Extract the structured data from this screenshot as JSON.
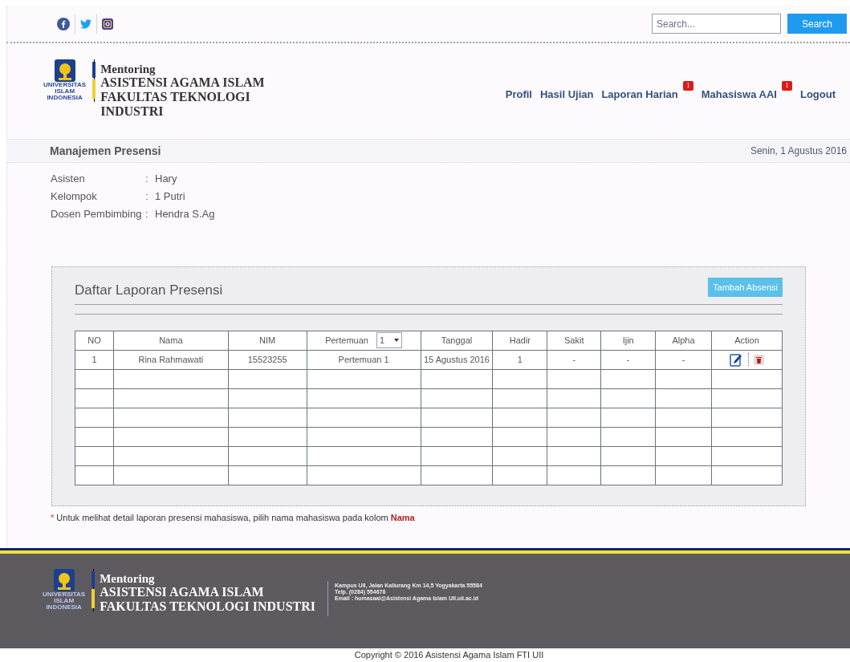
{
  "top_bar": {
    "search": {
      "placeholder": "Search..."
    },
    "search_button": "Search"
  },
  "header": {
    "logo_text": [
      "UNIVERSITAS",
      "ISLAM",
      "INDONESIA"
    ],
    "title_lines": [
      "Mentoring",
      "ASISTENSI AGAMA ISLAM",
      "FAKULTAS TEKNOLOGI",
      "INDUSTRI"
    ],
    "nav": [
      {
        "label": "Profil"
      },
      {
        "label": "Hasil Ujian"
      },
      {
        "label": "Laporan Harian",
        "badge": "1"
      },
      {
        "label": "Mahasiswa AAI",
        "badge": "1"
      },
      {
        "label": "Logout"
      }
    ]
  },
  "page_bar": {
    "title": "Manajemen Presensi",
    "date": "Senin, 1 Agustus 2016"
  },
  "info": [
    {
      "label": "Asisten",
      "separator": ":",
      "value": "Hary"
    },
    {
      "label": "Kelompok",
      "separator": ":",
      "value": "1 Putri"
    },
    {
      "label": "Dosen Pembimbing",
      "separator": ":",
      "value": "Hendra S.Ag"
    }
  ],
  "panel": {
    "title": "Daftar Laporan Presensi",
    "add_button": "Tambah Absensi",
    "table": {
      "columns": [
        "NO",
        "Nama",
        "NIM",
        "Pertemuan",
        "Tanggal",
        "Hadir",
        "Sakit",
        "Ijin",
        "Alpha",
        "Action"
      ],
      "pertemuan_select": "1",
      "rows": [
        {
          "cells": [
            "1",
            "Rina Rahmawati",
            "15523255",
            "Pertemuan 1",
            "15 Agustus 2016",
            "1",
            "-",
            "-",
            "-"
          ]
        }
      ]
    }
  },
  "note": {
    "text": "Untuk melihat detail laporan presensi mahasiswa, pilih nama mahasiswa pada kolom",
    "marker": "*",
    "highlight": "Nama"
  },
  "footer": {
    "logo_text": [
      "UNIVERSITAS",
      "ISLAM",
      "INDONESIA"
    ],
    "title_lines": [
      "Mentoring",
      "ASISTENSI AGAMA ISLAM",
      "FAKULTAS TEKNOLOGI INDUSTRI"
    ],
    "contact": [
      "Kampus UII, Jalan Kaliurang Km 14,5 Yogyakarta 55584",
      "Telp. (0284) 554678",
      "Email : humasaai@Asistensi Agama Islam UII.uii.ac.id"
    ],
    "copyright": "Copyright © 2016 Asistensi Agama Islam FTI UII"
  }
}
